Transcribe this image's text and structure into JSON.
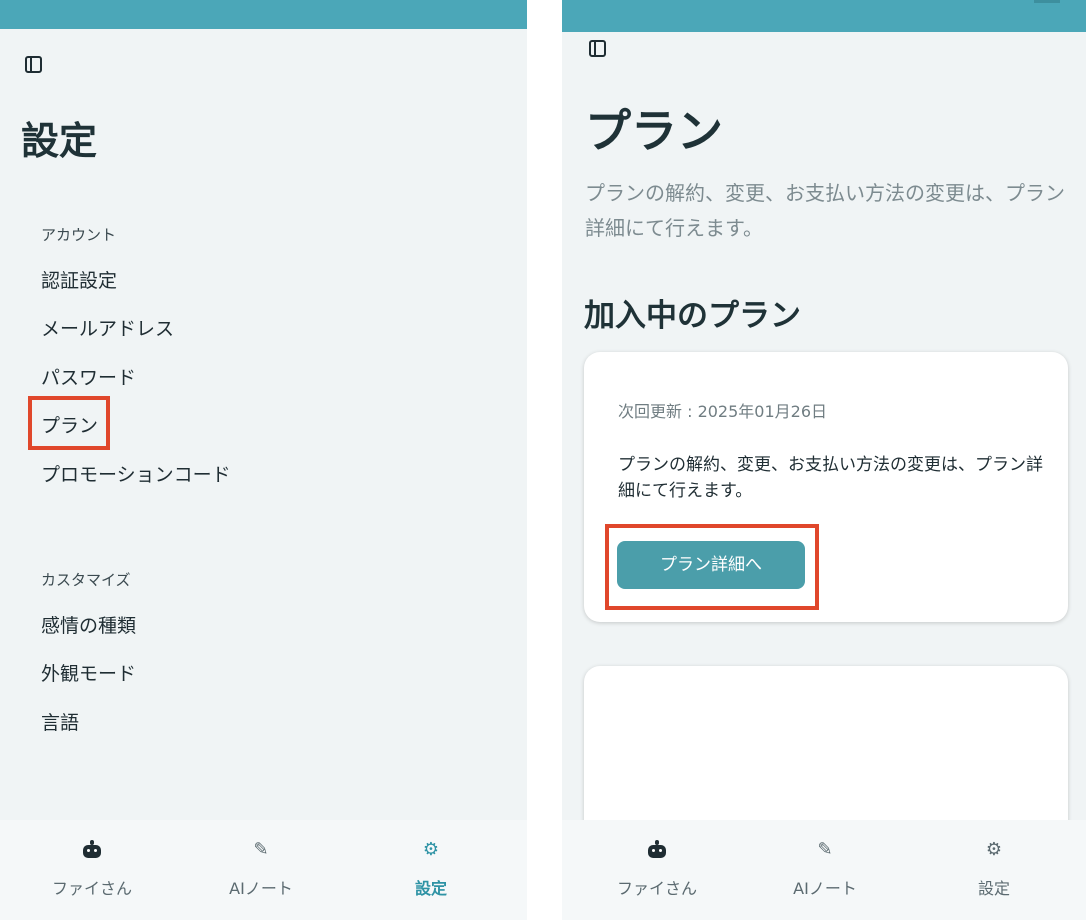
{
  "left": {
    "title": "設定",
    "sections": [
      {
        "header": "アカウント",
        "items": [
          "認証設定",
          "メールアドレス",
          "パスワード",
          "プラン",
          "プロモーションコード"
        ]
      },
      {
        "header": "カスタマイズ",
        "items": [
          "感情の種類",
          "外観モード",
          "言語"
        ]
      }
    ]
  },
  "right": {
    "title": "プラン",
    "description": "プランの解約、変更、お支払い方法の変更は、プラン詳細にて行えます。",
    "section_title": "加入中のプラン",
    "card": {
      "renewal": "次回更新 : 2025年01月26日",
      "description": "プランの解約、変更、お支払い方法の変更は、プラン詳細にて行えます。",
      "button": "プラン詳細へ"
    }
  },
  "tabbar": {
    "tabs": [
      {
        "label": "ファイさん",
        "icon": "robot-icon"
      },
      {
        "label": "AIノート",
        "icon": "edit-note-icon"
      },
      {
        "label": "設定",
        "icon": "gear-icon"
      }
    ]
  },
  "colors": {
    "header_teal": "#4ba7b8",
    "button_teal": "#4b9eaa",
    "active_tab": "#2e93a5",
    "highlight_red": "#e0472b",
    "background": "#f0f4f5"
  }
}
